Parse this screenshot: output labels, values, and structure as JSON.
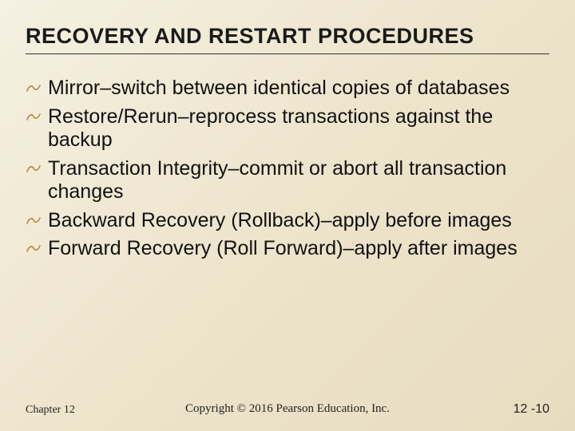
{
  "title": "RECOVERY AND RESTART PROCEDURES",
  "bullet_char": "ಠ",
  "bullets": [
    "Mirror–switch between identical copies of databases",
    "Restore/Rerun–reprocess transactions against the backup",
    "Transaction Integrity–commit or abort all transaction changes",
    "Backward Recovery (Rollback)–apply before images",
    "Forward Recovery (Roll Forward)–apply after images"
  ],
  "footer": {
    "left": "Chapter 12",
    "center": "Copyright © 2016 Pearson Education, Inc.",
    "right": "12 -10"
  }
}
